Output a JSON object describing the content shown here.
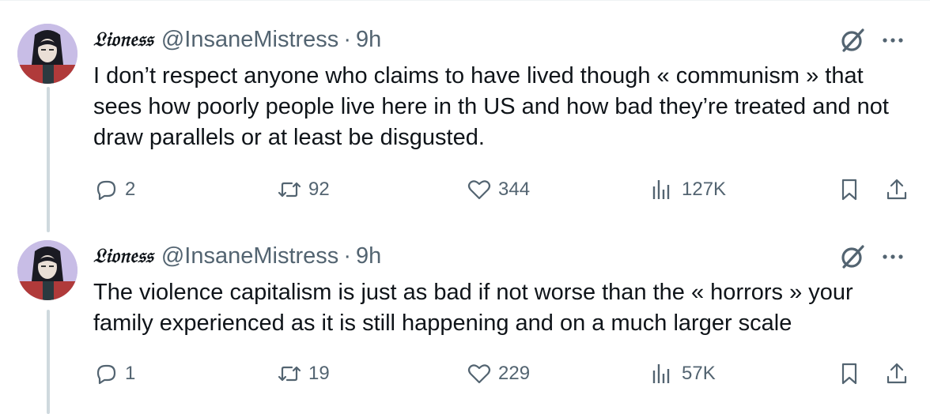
{
  "tweets": [
    {
      "display_name": "𝔏𝔦𝔬𝔫𝔢𝔰𝔰",
      "handle": "@InsaneMistress",
      "separator": "·",
      "time": "9h",
      "text": "I don’t respect anyone who claims to have lived though « communism » that sees how poorly people live here in th US and how bad they’re treated and not draw parallels or at least be disgusted.",
      "replies": "2",
      "reposts": "92",
      "likes": "344",
      "views": "127K"
    },
    {
      "display_name": "𝔏𝔦𝔬𝔫𝔢𝔰𝔰",
      "handle": "@InsaneMistress",
      "separator": "·",
      "time": "9h",
      "text": "The violence capitalism is just as bad if not worse than the « horrors » your family experienced as it is still happening and on a much larger scale",
      "replies": "1",
      "reposts": "19",
      "likes": "229",
      "views": "57K"
    }
  ],
  "icons": {
    "reply": "reply-icon",
    "repost": "repost-icon",
    "like": "heart-icon",
    "views": "views-icon",
    "bookmark": "bookmark-icon",
    "share": "share-icon",
    "grok": "grok-icon",
    "more": "more-icon"
  },
  "colors": {
    "text": "#0f1419",
    "secondary": "#536471",
    "thread_line": "#cfd9de",
    "avatar_bg": "#c8bde6"
  }
}
